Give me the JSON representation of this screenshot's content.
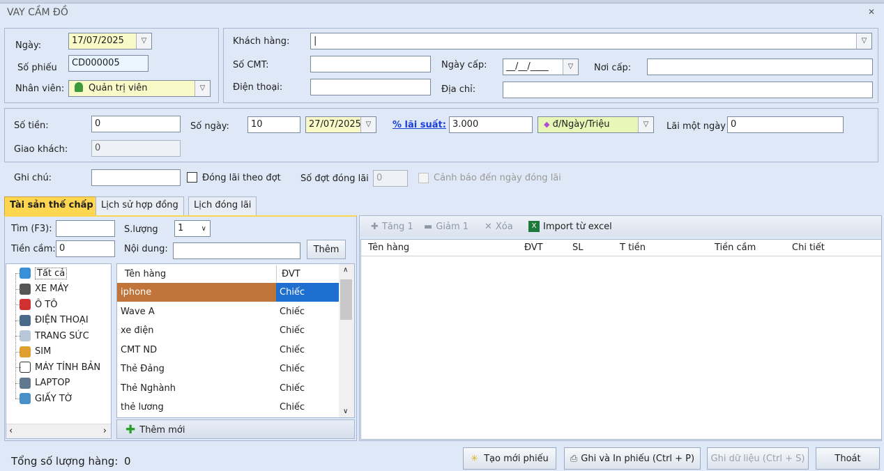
{
  "window": {
    "title": "VAY CẦM ĐỒ",
    "close_label": "✕"
  },
  "header": {
    "ngay_label": "Ngày:",
    "ngay_value": "17/07/2025",
    "so_phieu_label": "Số phiếu",
    "so_phieu_value": "CD000005",
    "nhan_vien_label": "Nhân viên:",
    "nhan_vien_value": "Quản trị viên"
  },
  "customer": {
    "khach_hang_label": "Khách hàng:",
    "khach_hang_value": "|",
    "so_cmt_label": "Số CMT:",
    "so_cmt_value": "",
    "ngay_cap_label": "Ngày cấp:",
    "ngay_cap_value": "__/__/____",
    "noi_cap_label": "Nơi cấp:",
    "noi_cap_value": "",
    "dien_thoai_label": "Điện thoại:",
    "dien_thoai_value": "",
    "dia_chi_label": "Địa chỉ:",
    "dia_chi_value": ""
  },
  "loan": {
    "so_tien_label": "Số tiền:",
    "so_tien_value": "0",
    "so_ngay_label": "Số ngày:",
    "so_ngay_value": "10",
    "due_date": "27/07/2025",
    "lai_suat_label": "% lãi suất:",
    "lai_suat_value": "3.000",
    "lai_unit": "đ/Ngày/Triệu",
    "lai_mot_ngay_label": "Lãi một ngày",
    "lai_mot_ngay_value": "0",
    "giao_khach_label": "Giao khách:",
    "giao_khach_value": "0"
  },
  "notes": {
    "ghi_chu_label": "Ghi chú:",
    "ghi_chu_value": "",
    "dong_lai_label": "Đóng lãi theo đợt",
    "so_dot_label": "Số đợt đóng lãi",
    "so_dot_value": "0",
    "canh_bao_label": "Cảnh báo đến ngày đóng lãi"
  },
  "tabs": [
    {
      "label": "Tài sản thế chấp",
      "active": true
    },
    {
      "label": "Lịch sử hợp đồng",
      "active": false
    },
    {
      "label": "Lịch đóng lãi",
      "active": false
    }
  ],
  "asset": {
    "tim_label": "Tìm (F3):",
    "tim_value": "",
    "sl_label": "S.lượng",
    "sl_value": "1",
    "tien_cam_label": "Tiền cầm:",
    "tien_cam_value": "0",
    "noi_dung_label": "Nội dung:",
    "noi_dung_value": "",
    "them_label": "Thêm",
    "add_new_label": "Thêm mới"
  },
  "tree": [
    {
      "label": "Tất cả",
      "icon": "globe-icon",
      "color": "#3a8fd8"
    },
    {
      "label": "XE MÁY",
      "icon": "motorbike-icon",
      "color": "#555555"
    },
    {
      "label": "Ô TÔ",
      "icon": "car-icon",
      "color": "#d03030"
    },
    {
      "label": "ĐIỆN THOẠI",
      "icon": "phone-icon",
      "color": "#4a6a8a"
    },
    {
      "label": "TRANG SỨC",
      "icon": "diamond-icon",
      "color": "#b8c8d8"
    },
    {
      "label": "SIM",
      "icon": "sim-icon",
      "color": "#e0a030"
    },
    {
      "label": "MÁY TÍNH BẢN",
      "icon": "tablet-icon",
      "color": "#ffffff"
    },
    {
      "label": "LAPTOP",
      "icon": "laptop-icon",
      "color": "#607890"
    },
    {
      "label": "GIẤY TỜ",
      "icon": "id-card-icon",
      "color": "#4a90c8"
    }
  ],
  "product_grid": {
    "headers": [
      "Tên hàng",
      "ĐVT"
    ],
    "rows": [
      [
        "iphone",
        "Chiếc"
      ],
      [
        "Wave A",
        "Chiếc"
      ],
      [
        "xe điện",
        "Chiếc"
      ],
      [
        "CMT ND",
        "Chiếc"
      ],
      [
        "Thẻ Đảng",
        "Chiếc"
      ],
      [
        "Thẻ Nghành",
        "Chiếc"
      ],
      [
        "thẻ lương",
        "Chiếc"
      ]
    ]
  },
  "toolbar": {
    "tang": "Tăng 1",
    "giam": "Giảm 1",
    "xoa": "Xóa",
    "import": "Import từ excel"
  },
  "detail_grid": {
    "headers": [
      "Tên hàng",
      "ĐVT",
      "SL",
      "T tiền",
      "Tiền cầm",
      "Chi tiết"
    ]
  },
  "footer": {
    "tong_label": "Tổng số lượng hàng:",
    "tong_value": "0",
    "tao_moi": "Tạo mới phiếu",
    "ghi_in": "Ghi và In phiếu (Ctrl + P)",
    "ghi_du_lieu": "Ghi dữ liệu (Ctrl + S)",
    "thoat": "Thoát"
  }
}
